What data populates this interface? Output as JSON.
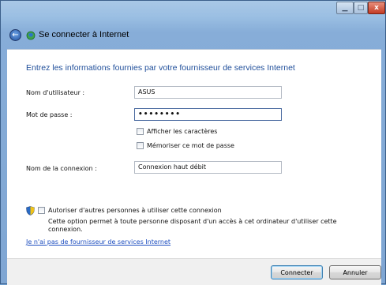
{
  "window": {
    "title": "Se connecter à Internet",
    "controls": {
      "minimize": "▁",
      "maximize": "□",
      "close": "x"
    }
  },
  "colors": {
    "accent": "#1f4e9a",
    "link": "#1c4dbf"
  },
  "form": {
    "heading": "Entrez les informations fournies par votre fournisseur de services Internet",
    "username": {
      "label": "Nom d'utilisateur :",
      "value": "ASUS"
    },
    "password": {
      "label": "Mot de passe :",
      "value": "••••••••"
    },
    "show_chars": {
      "label": "Afficher les caractères",
      "checked": false
    },
    "remember": {
      "label": "Mémoriser ce mot de passe",
      "checked": false
    },
    "connection_name": {
      "label": "Nom de la connexion :",
      "value": "Connexion haut débit"
    },
    "allow_others": {
      "label": "Autoriser d'autres personnes à utiliser cette connexion",
      "description": "Cette option permet à toute personne disposant d'un accès à cet ordinateur d'utiliser cette connexion.",
      "checked": false
    },
    "no_isp_link": "Je n'ai pas de fournisseur de services Internet"
  },
  "buttons": {
    "connect": "Connecter",
    "cancel": "Annuler"
  },
  "icons": {
    "back": "back-arrow-icon",
    "app": "network-globe-icon",
    "shield": "uac-shield-icon"
  }
}
